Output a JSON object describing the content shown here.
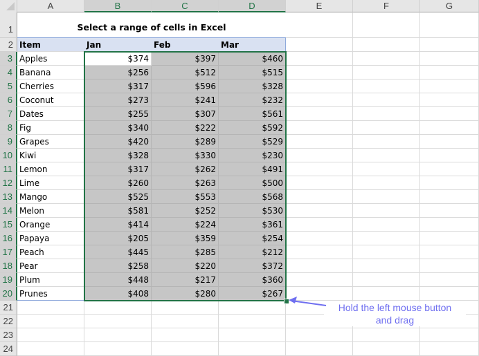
{
  "spreadsheet": {
    "columns": [
      "A",
      "B",
      "C",
      "D",
      "E",
      "F",
      "G"
    ],
    "selected_columns": [
      "B",
      "C",
      "D"
    ],
    "rows": [
      "1",
      "2",
      "3",
      "4",
      "5",
      "6",
      "7",
      "8",
      "9",
      "10",
      "11",
      "12",
      "13",
      "14",
      "15",
      "16",
      "17",
      "18",
      "19",
      "20",
      "21",
      "22",
      "23",
      "24"
    ],
    "selected_range": "B3:D20",
    "active_cell": "B3",
    "title": "Select a range of cells in Excel",
    "headers": [
      "Item",
      "Jan",
      "Feb",
      "Mar"
    ],
    "data": [
      [
        "Apples",
        "$374",
        "$397",
        "$460"
      ],
      [
        "Banana",
        "$256",
        "$512",
        "$515"
      ],
      [
        "Cherries",
        "$317",
        "$596",
        "$328"
      ],
      [
        "Coconut",
        "$273",
        "$241",
        "$232"
      ],
      [
        "Dates",
        "$255",
        "$307",
        "$561"
      ],
      [
        "Fig",
        "$340",
        "$222",
        "$592"
      ],
      [
        "Grapes",
        "$420",
        "$289",
        "$529"
      ],
      [
        "Kiwi",
        "$328",
        "$330",
        "$230"
      ],
      [
        "Lemon",
        "$317",
        "$262",
        "$491"
      ],
      [
        "Lime",
        "$260",
        "$263",
        "$500"
      ],
      [
        "Mango",
        "$525",
        "$553",
        "$568"
      ],
      [
        "Melon",
        "$581",
        "$252",
        "$530"
      ],
      [
        "Orange",
        "$414",
        "$224",
        "$361"
      ],
      [
        "Papaya",
        "$205",
        "$359",
        "$254"
      ],
      [
        "Peach",
        "$445",
        "$285",
        "$212"
      ],
      [
        "Pear",
        "$258",
        "$220",
        "$372"
      ],
      [
        "Plum",
        "$448",
        "$217",
        "$360"
      ],
      [
        "Prunes",
        "$408",
        "$280",
        "$267"
      ]
    ]
  },
  "annotation": {
    "text": "Hold the left mouse button and drag",
    "line1": "Hold the left mouse button",
    "line2": "and drag",
    "icon": "arrow-left-icon"
  },
  "colors": {
    "selection_border": "#217346",
    "selection_fill": "#c6c6c6",
    "header_fill": "#d9e1f2",
    "annotation": "#6f6ff0"
  }
}
